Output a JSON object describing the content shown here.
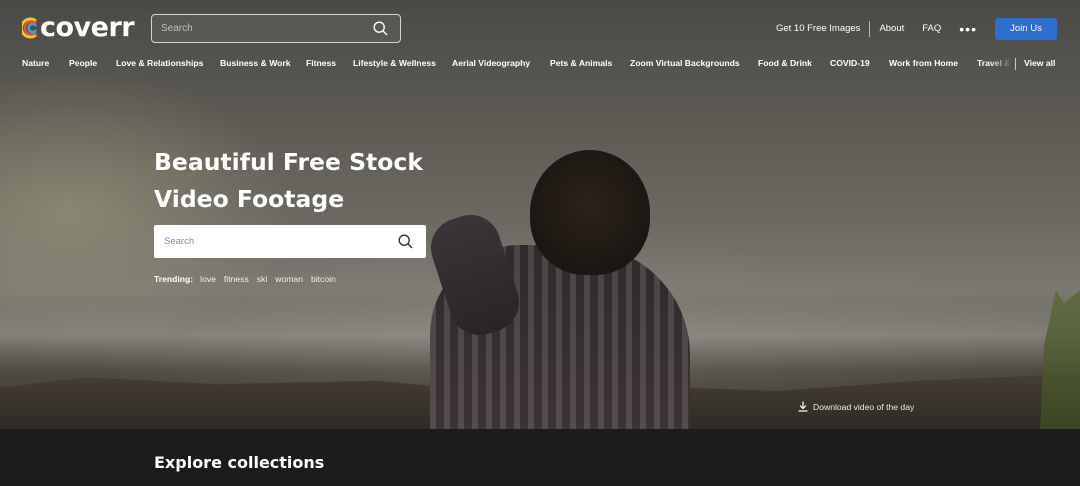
{
  "brand": {
    "name": "coverr"
  },
  "header": {
    "search_placeholder": "Search",
    "links": [
      "Get 10 Free Images",
      "About",
      "FAQ"
    ],
    "more": "•••",
    "join_label": "Join Us",
    "join_color": "#2d6fd1"
  },
  "categories": {
    "items": [
      "Nature",
      "People",
      "Love & Relationships",
      "Business & Work",
      "Fitness",
      "Lifestyle & Wellness",
      "Aerial Videography",
      "Pets & Animals",
      "Zoom Virtual Backgrounds",
      "Food & Drink",
      "COVID-19",
      "Work from Home",
      "Travel &"
    ],
    "view_all": "View all"
  },
  "hero": {
    "title_line1": "Beautiful Free Stock",
    "title_line2": "Video Footage",
    "search_placeholder": "Search",
    "trending_label": "Trending:",
    "trending": [
      "love",
      "fitness",
      "ski",
      "woman",
      "bitcoin"
    ],
    "download_label": "Download video of the day"
  },
  "explore": {
    "title": "Explore collections"
  }
}
